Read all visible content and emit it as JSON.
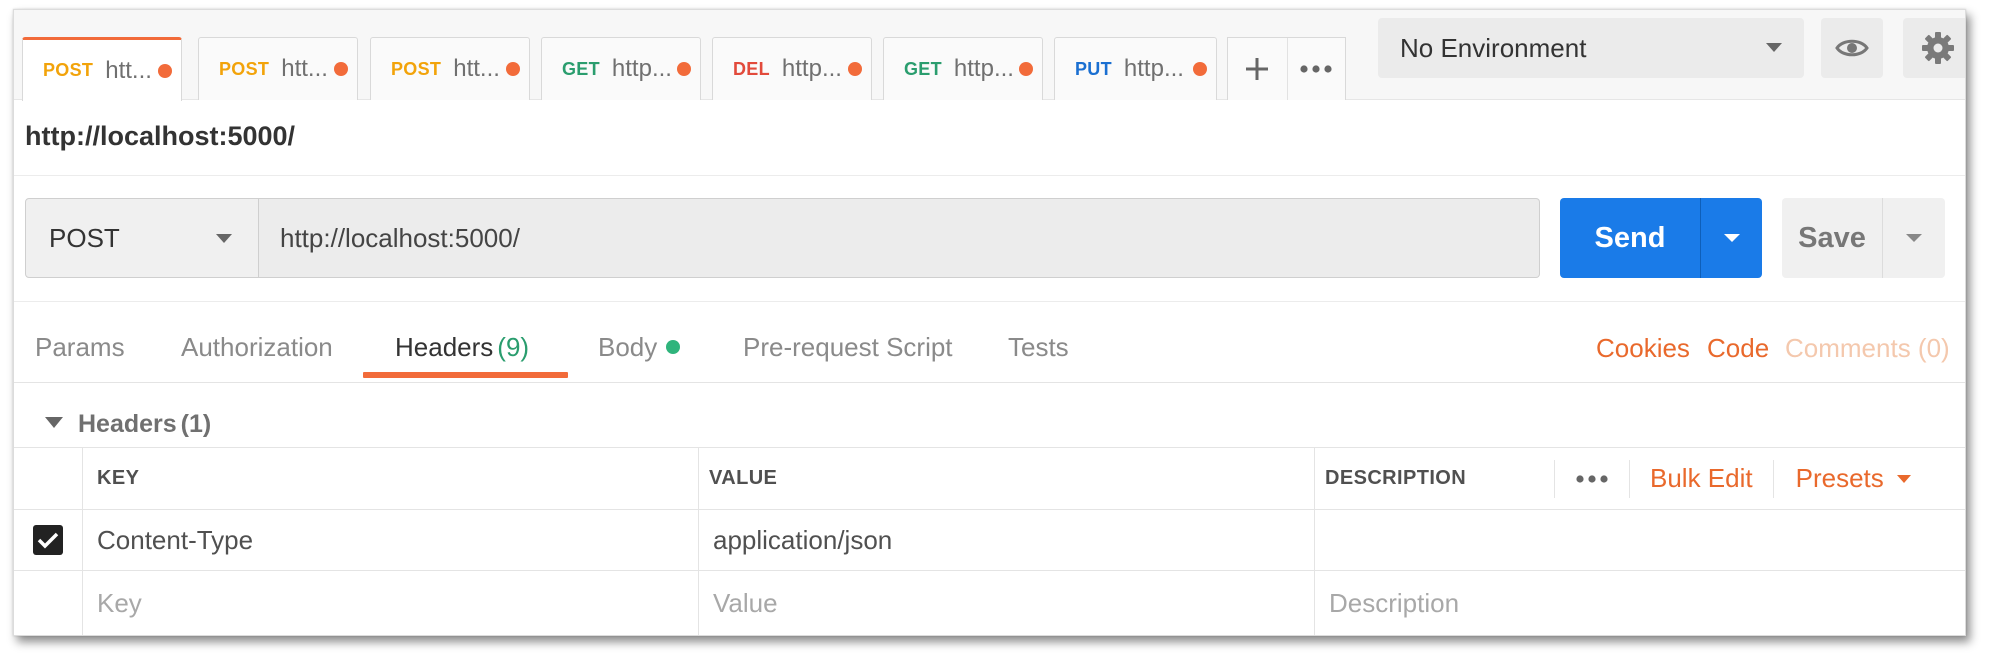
{
  "tabs": [
    {
      "method": "POST",
      "method_color": "#f2a30a",
      "url": "htt...",
      "active": true
    },
    {
      "method": "POST",
      "method_color": "#f2a30a",
      "url": "htt...",
      "active": false
    },
    {
      "method": "POST",
      "method_color": "#f2a30a",
      "url": "htt...",
      "active": false
    },
    {
      "method": "GET",
      "method_color": "#2a9d6e",
      "url": "http...",
      "active": false
    },
    {
      "method": "DEL",
      "method_color": "#e24a3b",
      "url": "http...",
      "active": false
    },
    {
      "method": "GET",
      "method_color": "#2a9d6e",
      "url": "http...",
      "active": false
    },
    {
      "method": "PUT",
      "method_color": "#1a6fd1",
      "url": "http...",
      "active": false
    }
  ],
  "tab_tools": {
    "add_icon": "plus-icon",
    "more_icon": "more-dots-icon"
  },
  "environment": {
    "selected": "No Environment",
    "eye_icon": "eye-icon",
    "settings_icon": "gear-icon"
  },
  "request": {
    "title": "http://localhost:5000/",
    "method": "POST",
    "url": "http://localhost:5000/",
    "send_label": "Send",
    "save_label": "Save"
  },
  "subtabs": {
    "params": "Params",
    "authorization": "Authorization",
    "headers": "Headers",
    "headers_count": "(9)",
    "body": "Body",
    "prerequest": "Pre-request Script",
    "tests": "Tests"
  },
  "links": {
    "cookies": "Cookies",
    "code": "Code",
    "comments": "Comments (0)"
  },
  "headers_section": {
    "title": "Headers",
    "count": "(1)",
    "columns": {
      "key": "KEY",
      "value": "VALUE",
      "description": "DESCRIPTION"
    },
    "bulk_edit": "Bulk Edit",
    "presets": "Presets",
    "rows": [
      {
        "checked": true,
        "key": "Content-Type",
        "value": "application/json",
        "description": ""
      }
    ],
    "placeholders": {
      "key": "Key",
      "value": "Value",
      "description": "Description"
    }
  },
  "colors": {
    "accent": "#f26b3a",
    "send": "#1a7be8",
    "link": "#e9692c",
    "success": "#2fb47c"
  }
}
